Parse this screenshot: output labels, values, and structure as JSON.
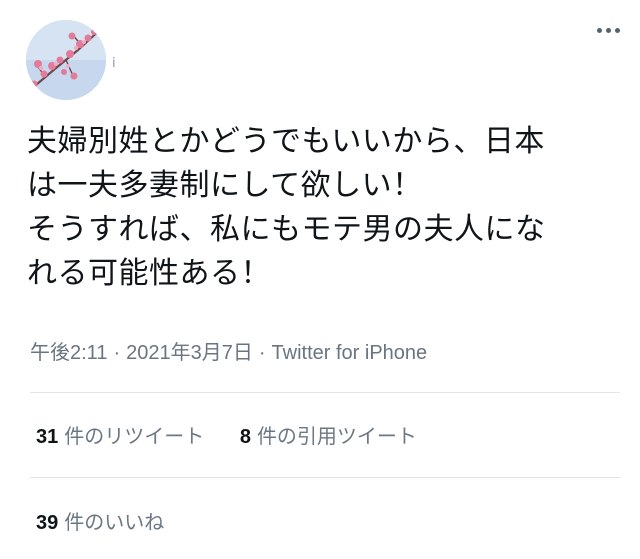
{
  "user": {
    "username": "i"
  },
  "tweet": {
    "text": "夫婦別姓とかどうでもいいから、日本\nは一夫多妻制にして欲しい！\nそうすれば、私にもモテ男の夫人にな\nれる可能性ある！",
    "time": "午後2:11",
    "date": "2021年3月7日",
    "source": "Twitter for iPhone",
    "separator": "·"
  },
  "stats": {
    "retweets_count": "31",
    "retweets_label": "件のリツイート",
    "quotes_count": "8",
    "quotes_label": "件の引用ツイート",
    "likes_count": "39",
    "likes_label": "件のいいね"
  },
  "icons": {
    "more": "more-options-icon"
  }
}
